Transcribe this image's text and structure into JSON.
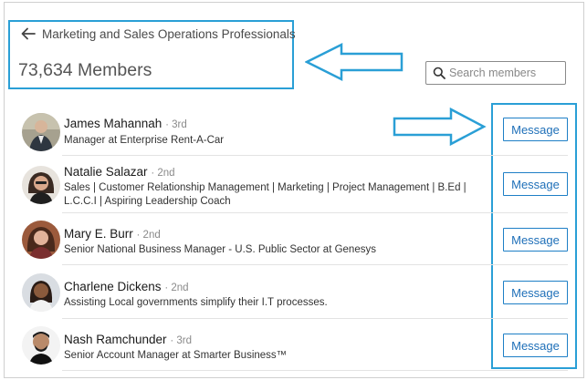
{
  "header": {
    "group_title": "Marketing and Sales Operations Professionals",
    "member_count": "73,634 Members"
  },
  "search": {
    "placeholder": "Search members",
    "value": ""
  },
  "members": [
    {
      "name": "James Mahannah",
      "degree": "· 3rd",
      "headline": "Manager at Enterprise Rent-A-Car",
      "action": "Message"
    },
    {
      "name": "Natalie Salazar",
      "degree": "· 2nd",
      "headline": "Sales | Customer Relationship Management | Marketing | Project Management | B.Ed | L.C.C.I | Aspiring Leadership Coach",
      "action": "Message"
    },
    {
      "name": "Mary E. Burr",
      "degree": "· 2nd",
      "headline": "Senior National Business Manager - U.S. Public Sector at Genesys",
      "action": "Message"
    },
    {
      "name": "Charlene Dickens",
      "degree": "· 2nd",
      "headline": "Assisting Local governments simplify their I.T processes.",
      "action": "Message"
    },
    {
      "name": "Nash Ramchunder",
      "degree": "· 3rd",
      "headline": "Senior Account Manager at Smarter Business™",
      "action": "Message"
    }
  ],
  "colors": {
    "annotation": "#2a9fd6",
    "button_border": "#1e7fc6",
    "button_text": "#1e6fb8"
  },
  "icons": {
    "back": "arrow-left-icon",
    "search": "search-icon"
  }
}
